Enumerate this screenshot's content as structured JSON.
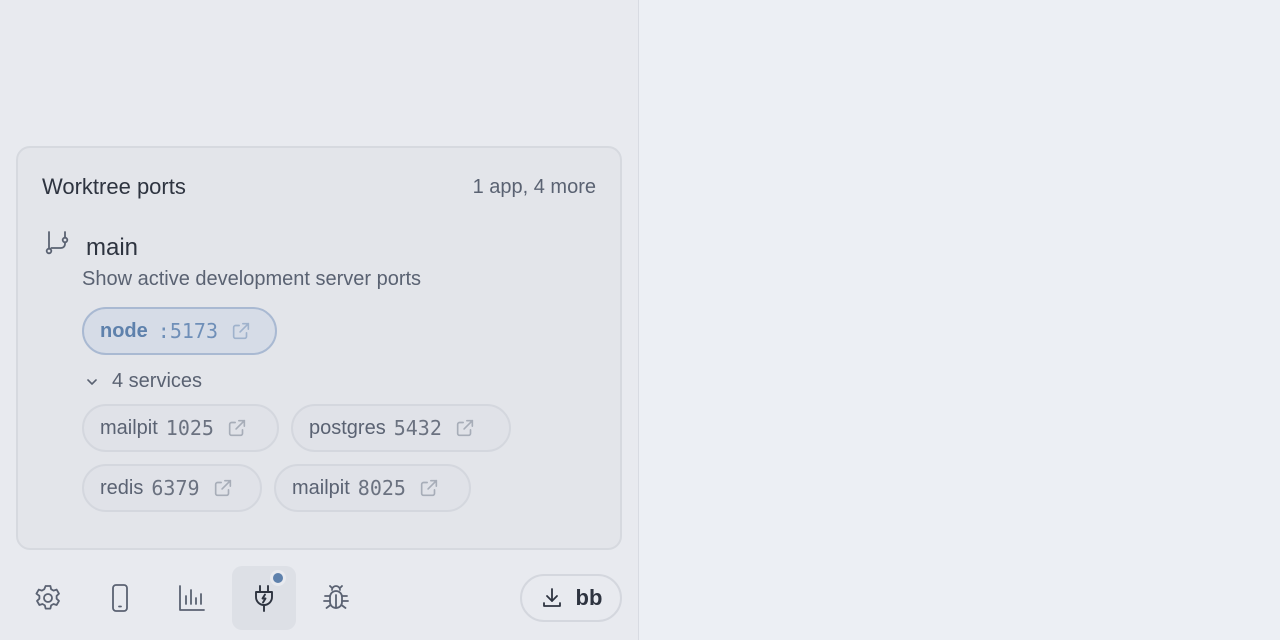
{
  "ports_panel": {
    "title": "Worktree ports",
    "summary": "1 app, 4 more",
    "branch": {
      "icon": "git-branch-icon",
      "name": "main",
      "description": "Show active development server ports"
    },
    "app": {
      "name": "node",
      "port": ":5173",
      "icon": "external-link-icon"
    },
    "services_toggle": {
      "label": "4 services",
      "icon": "chevron-down-icon",
      "expanded": true
    },
    "services": [
      {
        "name": "mailpit",
        "port": "1025"
      },
      {
        "name": "postgres",
        "port": "5432"
      },
      {
        "name": "redis",
        "port": "6379"
      },
      {
        "name": "mailpit",
        "port": "8025"
      }
    ]
  },
  "toolbar": {
    "buttons": [
      {
        "icon": "gear-icon",
        "active": false
      },
      {
        "icon": "mobile-device-icon",
        "active": false
      },
      {
        "icon": "bar-chart-icon",
        "active": false
      },
      {
        "icon": "plug-icon",
        "active": true,
        "badge": true
      },
      {
        "icon": "bug-icon",
        "active": false
      }
    ],
    "download": {
      "icon": "download-icon",
      "label": "bb"
    }
  },
  "colors": {
    "accent": "#5e81ac",
    "background": "#eceff4",
    "sidebar": "#e8eaef",
    "card": "#e3e5ea"
  }
}
